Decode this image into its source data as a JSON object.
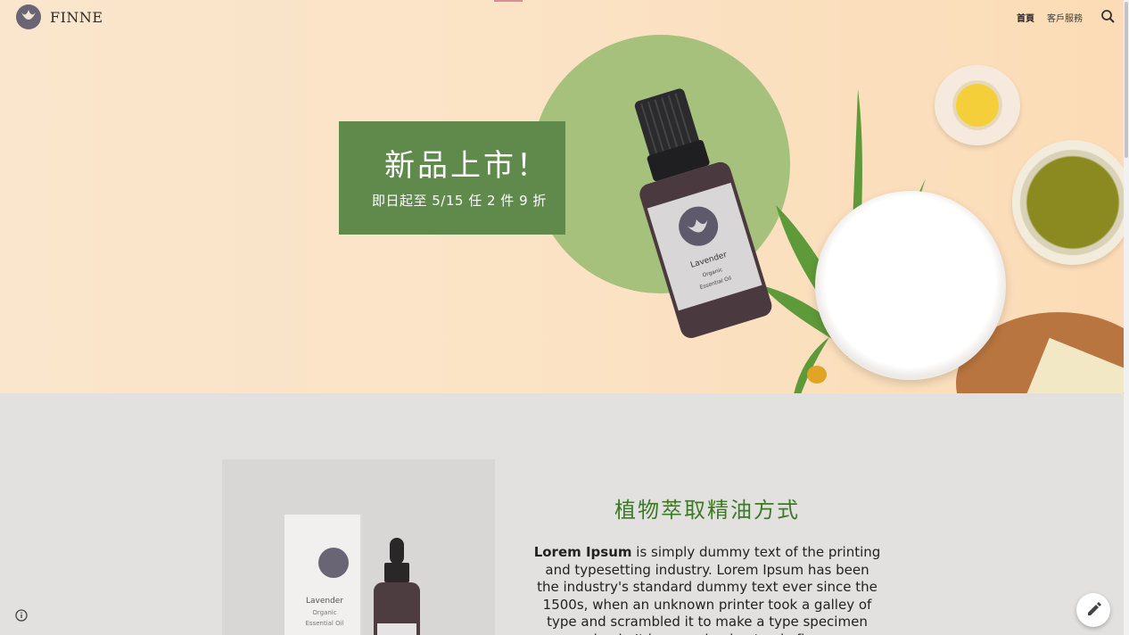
{
  "header": {
    "brand": "FINNE",
    "nav": [
      {
        "label": "首頁",
        "active": true
      },
      {
        "label": "客戶服務",
        "active": false
      }
    ],
    "search_icon": "search-icon"
  },
  "hero": {
    "promo_title": "新品上市！",
    "promo_subtitle": "即日起至 5/15 任 2 件 9 折",
    "bottle_label": "Lavender",
    "bottle_sub1": "Organic",
    "bottle_sub2": "Essential Oil"
  },
  "section": {
    "title": "植物萃取精油方式",
    "body_bold": "Lorem Ipsum",
    "body_rest": " is simply dummy text of the printing and typesetting industry. Lorem Ipsum has been the industry's standard dummy text ever since the 1500s, when an unknown printer took a galley of type and scrambled it to make a type specimen book. It has survived not only five",
    "box_label": "Lavender",
    "box_sub1": "Organic",
    "box_sub2": "Essential Oil"
  },
  "colors": {
    "promo_bg": "#608a4c",
    "circle": "#a6c17c",
    "title_green": "#3c7a25",
    "hero_bg": "#fae6cc",
    "page_bg": "#e2e1df"
  },
  "icons": {
    "info": "info-icon",
    "edit": "pencil-icon"
  }
}
